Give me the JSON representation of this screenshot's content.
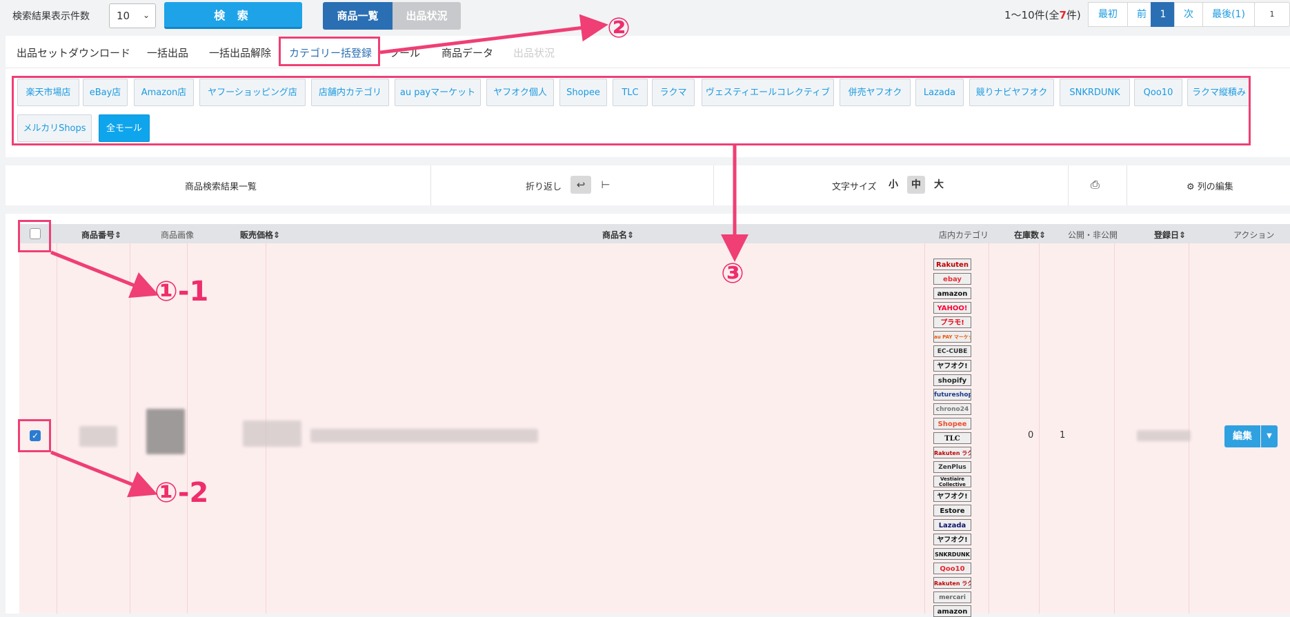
{
  "topbar": {
    "count_label": "検索結果表示件数",
    "count_value": "10",
    "search_button": "検 索",
    "view_products": "商品一覧",
    "view_listing": "出品状況",
    "range_prefix": "1～10件(全",
    "range_total": "7",
    "range_suffix": "件)",
    "pager": {
      "first": "最初",
      "prev": "前",
      "current": "1",
      "next": "次",
      "last": "最後(1)",
      "extra": "1"
    }
  },
  "tabs": [
    "出品セットダウンロード",
    "一括出品",
    "一括出品解除",
    "カテゴリー括登録",
    "ツール",
    "商品データ",
    "出品状況"
  ],
  "categories": [
    "楽天市場店",
    "eBay店",
    "Amazon店",
    "ヤフーショッピング店",
    "店舗内カテゴリ",
    "au payマーケット",
    "ヤフオク個人",
    "Shopee",
    "TLC",
    "ラクマ",
    "ヴェスティエールコレクティブ",
    "併売ヤフオク",
    "Lazada",
    "競りナビヤフオク",
    "SNKRDUNK",
    "Qoo10",
    "ラクマ縦積み",
    "メルカリShops",
    "全モール"
  ],
  "toolbar": {
    "results_title": "商品検索結果一覧",
    "wrap_label": "折り返し",
    "font_size_label": "文字サイズ",
    "size_small": "小",
    "size_medium": "中",
    "size_large": "大",
    "edit_columns": "列の編集"
  },
  "table": {
    "headers": {
      "number": "商品番号",
      "image": "商品画像",
      "price": "販売価格",
      "name": "商品名",
      "store_category": "店内カテゴリ",
      "stock": "在庫数",
      "visibility": "公開・非公開",
      "date": "登録日",
      "action": "アクション"
    },
    "row": {
      "stock": "0",
      "visibility": "1",
      "edit_button": "編集"
    }
  },
  "mall_logos": [
    "Rakuten",
    "ebay",
    "amazon",
    "YAHOO!",
    "プラモ!",
    "au PAY マーケット",
    "EC-CUBE",
    "ヤフオク!",
    "shopify",
    "futureshop",
    "chrono24",
    "Shopee",
    "TLC",
    "Rakuten ラクマ",
    "ZenPlus",
    "Vestiaire Collective",
    "ヤフオク!",
    "Estore",
    "Lazada",
    "ヤフオク!",
    "SNKRDUNK",
    "Qoo10",
    "Rakuten ラクマ",
    "mercari",
    "amazon"
  ],
  "annotations": {
    "a1_1": "①-1",
    "a1_2": "①-2",
    "a2": "②",
    "a3": "③"
  },
  "colors": {
    "accent": "#1fa3e8",
    "primary_dark": "#2a6fb3",
    "annotation": "#ef3f74",
    "row_highlight": "#fdeeee"
  }
}
